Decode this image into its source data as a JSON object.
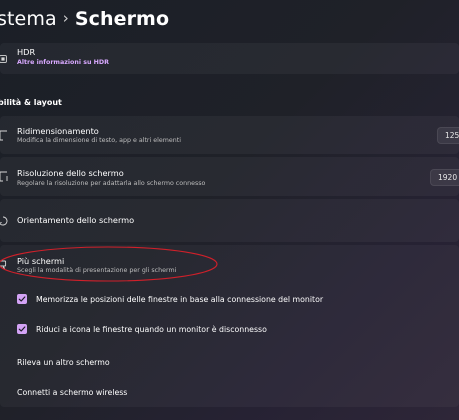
{
  "header": {
    "parent": "stema",
    "separator": "›",
    "current": "Schermo"
  },
  "hdr": {
    "icon": "hdr-icon",
    "title": "HDR",
    "link": "Altre informazioni su HDR"
  },
  "section": {
    "title": "bilità & layout"
  },
  "scale": {
    "icon": "scale-icon",
    "title": "Ridimensionamento",
    "subtitle": "Modifica la dimensione di testo, app e altri elementi",
    "value": "125"
  },
  "resolution": {
    "icon": "resolution-icon",
    "title": "Risoluzione dello schermo",
    "subtitle": "Regolare la risoluzione per adattarla allo schermo connesso",
    "value": "1920"
  },
  "orientation": {
    "icon": "orientation-icon",
    "title": "Orientamento dello schermo"
  },
  "multiple_displays": {
    "icon": "multiple-displays-icon",
    "title": "Più schermi",
    "subtitle": "Scegli la modalità di presentazione per gli schermi",
    "options": [
      {
        "label": "Memorizza le posizioni delle finestre in base alla connessione del monitor",
        "checked": true
      },
      {
        "label": "Riduci a icona le finestre quando un monitor è disconnesso",
        "checked": true
      }
    ],
    "detect_label": "Rileva un altro schermo",
    "wireless_label": "Connetti a schermo wireless"
  },
  "colors": {
    "accent": "#d3a3f5",
    "annotation": "#d0202a"
  }
}
